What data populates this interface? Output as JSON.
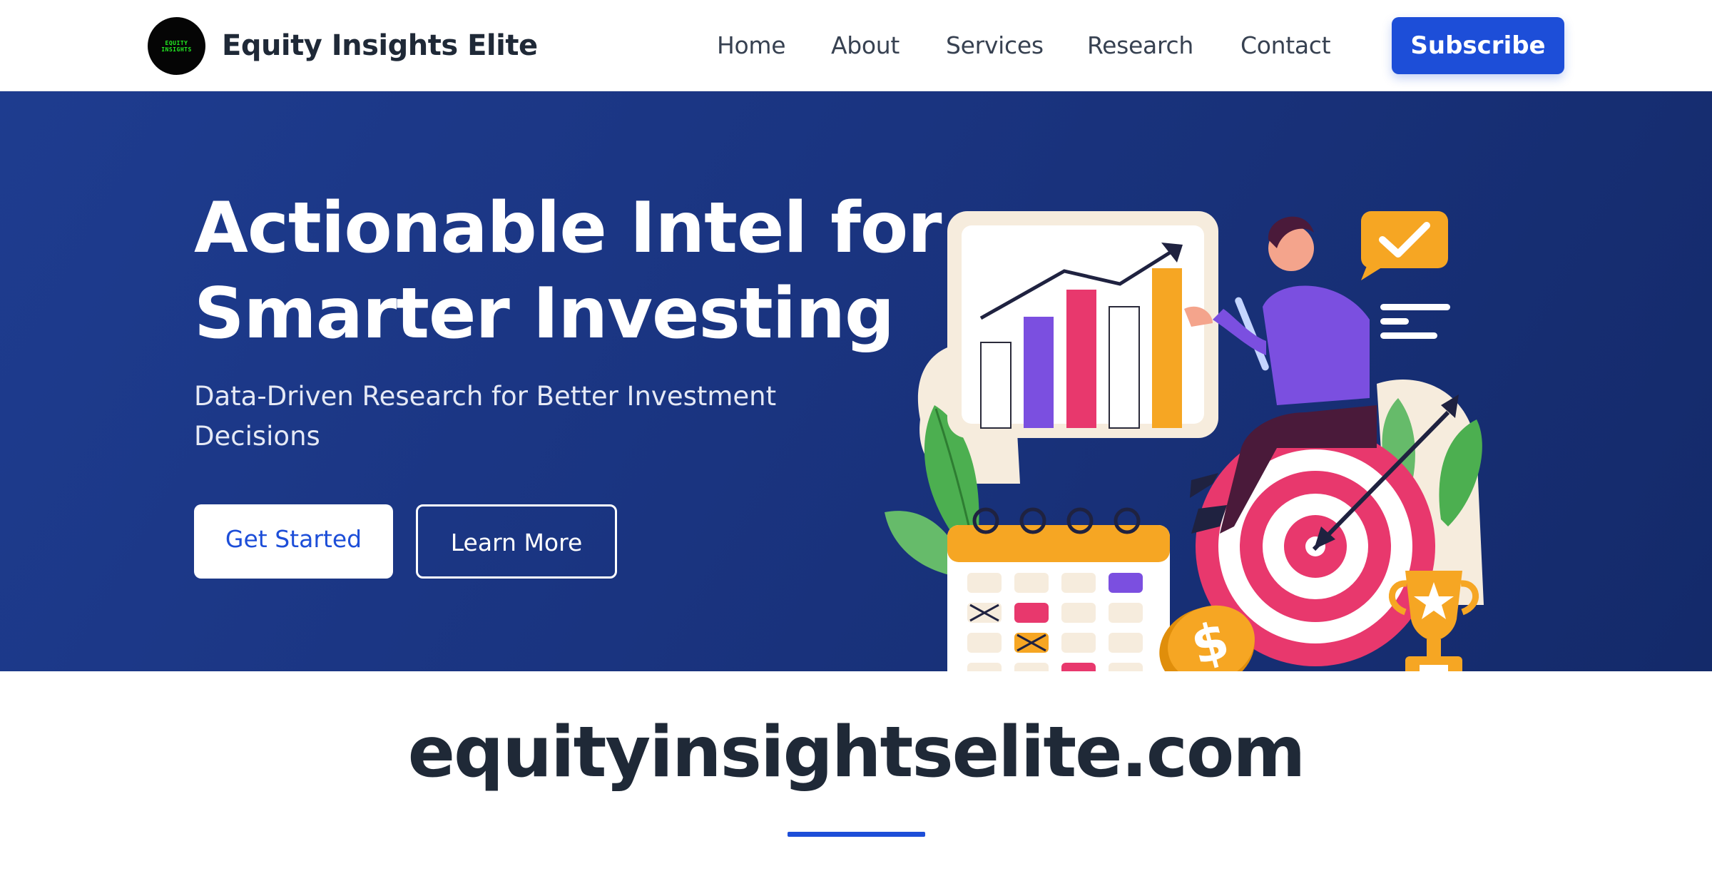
{
  "header": {
    "logo_text_line1": "EQUITY",
    "logo_text_line2": "INSIGHTS",
    "brand": "Equity Insights Elite",
    "nav": [
      {
        "label": "Home"
      },
      {
        "label": "About"
      },
      {
        "label": "Services"
      },
      {
        "label": "Research"
      },
      {
        "label": "Contact"
      }
    ],
    "subscribe_label": "Subscribe"
  },
  "hero": {
    "title_line1": "Actionable Intel for",
    "title_line2": "Smarter Investing",
    "subtitle": "Data-Driven Research for Better Investment Decisions",
    "primary_button": "Get Started",
    "secondary_button": "Learn More",
    "illustration_icons": [
      "bar-chart-icon",
      "checkmark-icon",
      "target-icon",
      "calendar-icon",
      "coin-icon",
      "trophy-icon",
      "plant-icon"
    ]
  },
  "footer_band": {
    "domain": "equityinsightselite.com"
  },
  "colors": {
    "accent": "#1d4ed8",
    "hero_bg": "#1a3480",
    "brand_text": "#1f2937"
  }
}
